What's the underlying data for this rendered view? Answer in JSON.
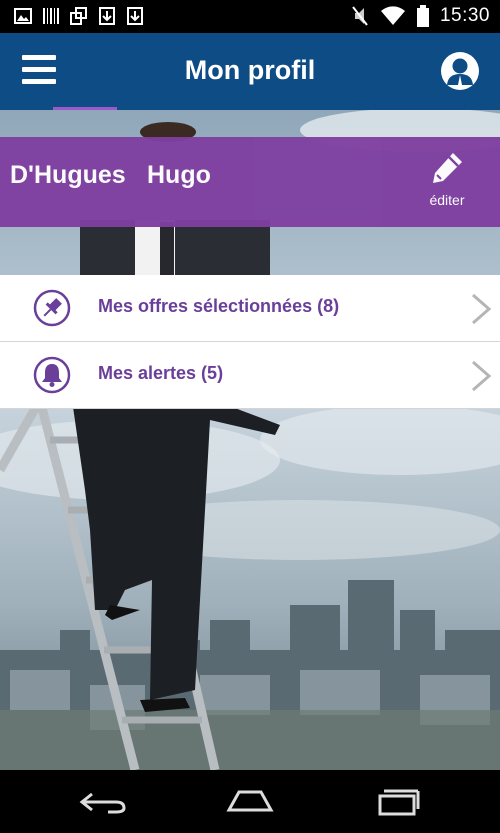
{
  "status_bar": {
    "time": "15:30",
    "left_icons": [
      "image-icon",
      "barcode-icon",
      "windows-icon",
      "download-icon",
      "download-icon"
    ],
    "right_icons": [
      "mute-icon",
      "wifi-icon",
      "battery-icon"
    ]
  },
  "app_bar": {
    "title": "Mon profil",
    "color": "#0e4c86",
    "accent": "#9b59c9"
  },
  "profile": {
    "last_name": "D'Hugues",
    "first_name": "Hugo",
    "edit_label": "éditer",
    "band_color": "#7f3fa0"
  },
  "menu": {
    "items": [
      {
        "label": "Mes offres sélectionnées (8)",
        "icon": "pin-icon"
      },
      {
        "label": "Mes alertes (5)",
        "icon": "bell-icon"
      }
    ]
  },
  "nav_bar": {
    "buttons": [
      "back-icon",
      "home-icon",
      "recents-icon"
    ]
  }
}
